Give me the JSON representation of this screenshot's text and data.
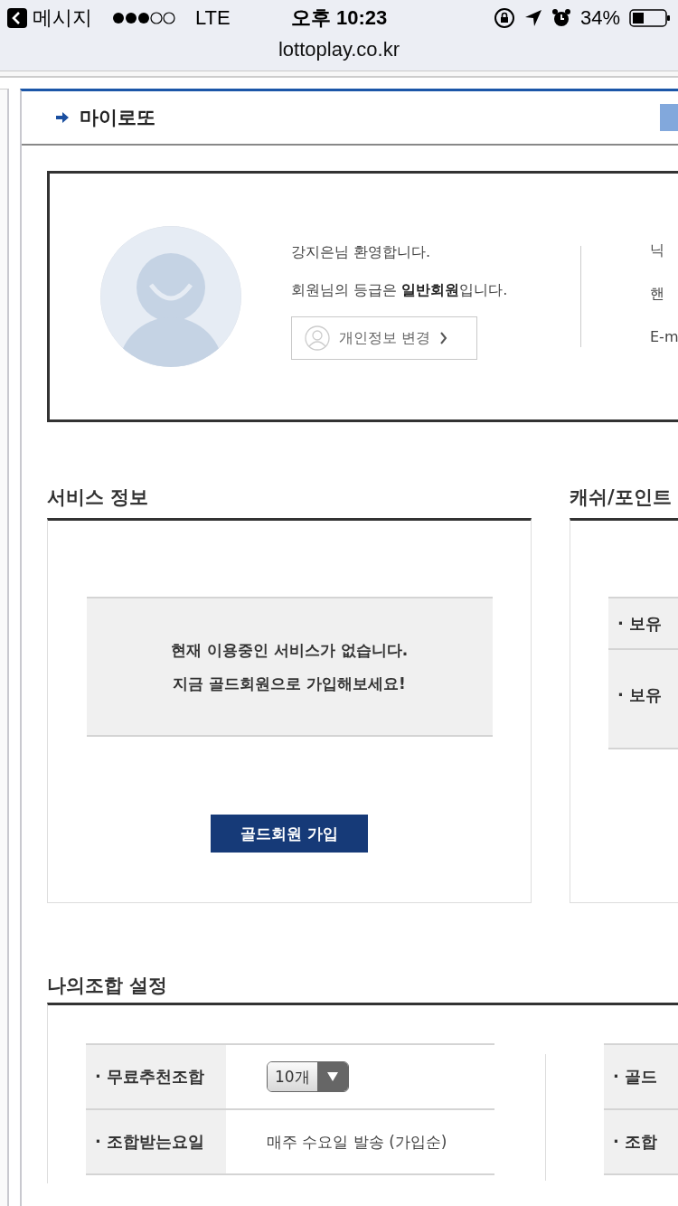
{
  "status_bar": {
    "back_label": "메시지",
    "carrier": "LTE",
    "time": "오후 10:23",
    "battery": "34%"
  },
  "address_bar": {
    "url": "lottoplay.co.kr"
  },
  "page_header": {
    "title": "마이로또"
  },
  "profile": {
    "welcome": "강지은님 환영합니다.",
    "grade": "회원님의 등급은 **일반회원**입니다.",
    "edit_button": "개인정보 변경",
    "details": [
      "닉",
      "핸",
      "E-m"
    ]
  },
  "service_info": {
    "title": "서비스 정보",
    "message_lines": [
      "현재 이용중인 서비스가 없습니다.",
      "지금 골드회원으로 가입해보세요!"
    ],
    "join_button": "골드회원 가입"
  },
  "cash_point": {
    "title": "캐쉬/포인트",
    "rows": [
      "· 보유",
      "· 보유"
    ]
  },
  "combination_settings": {
    "title": "나의조합 설정",
    "left_rows": [
      {
        "kind": "select",
        "label": "· 무료추천조합",
        "value": "10개"
      },
      {
        "kind": "text",
        "label": "· 조합받는요일",
        "value": "매주 수요일 발송 (가입순)"
      }
    ],
    "right_rows": [
      "· 골드",
      "· 조합"
    ]
  }
}
